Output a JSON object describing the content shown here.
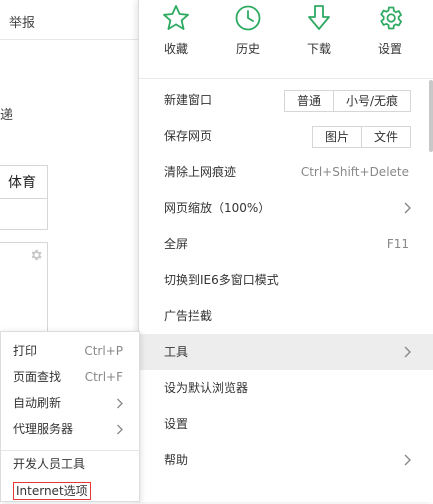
{
  "background": {
    "report_label": "举报",
    "partial_char": "递",
    "sports_label": "体育"
  },
  "colors": {
    "accent": "#2eaa62",
    "highlight_border": "#e53935",
    "hover_bg": "#ededed"
  },
  "top_actions": [
    {
      "label": "收藏",
      "icon": "star-icon"
    },
    {
      "label": "历史",
      "icon": "clock-icon"
    },
    {
      "label": "下载",
      "icon": "download-arrow-icon"
    },
    {
      "label": "设置",
      "icon": "gear-icon"
    }
  ],
  "menu": {
    "new_window": {
      "label": "新建窗口",
      "options": [
        "普通",
        "小号/无痕"
      ]
    },
    "save_page": {
      "label": "保存网页",
      "options": [
        "图片",
        "文件"
      ]
    },
    "clear_history": {
      "label": "清除上网痕迹",
      "shortcut": "Ctrl+Shift+Delete"
    },
    "zoom": {
      "label": "网页缩放（100%）"
    },
    "fullscreen": {
      "label": "全屏",
      "shortcut": "F11"
    },
    "ie6_mode": {
      "label": "切换到IE6多窗口模式"
    },
    "ad_block": {
      "label": "广告拦截"
    },
    "tools": {
      "label": "工具"
    },
    "set_default": {
      "label": "设为默认浏览器"
    },
    "settings": {
      "label": "设置"
    },
    "help": {
      "label": "帮助"
    }
  },
  "tools_submenu": {
    "print": {
      "label": "打印",
      "shortcut": "Ctrl+P"
    },
    "find": {
      "label": "页面查找",
      "shortcut": "Ctrl+F"
    },
    "auto_refresh": {
      "label": "自动刷新"
    },
    "proxy": {
      "label": "代理服务器"
    },
    "devtools": {
      "label": "开发人员工具"
    },
    "internet_options": {
      "label": "Internet选项"
    }
  }
}
